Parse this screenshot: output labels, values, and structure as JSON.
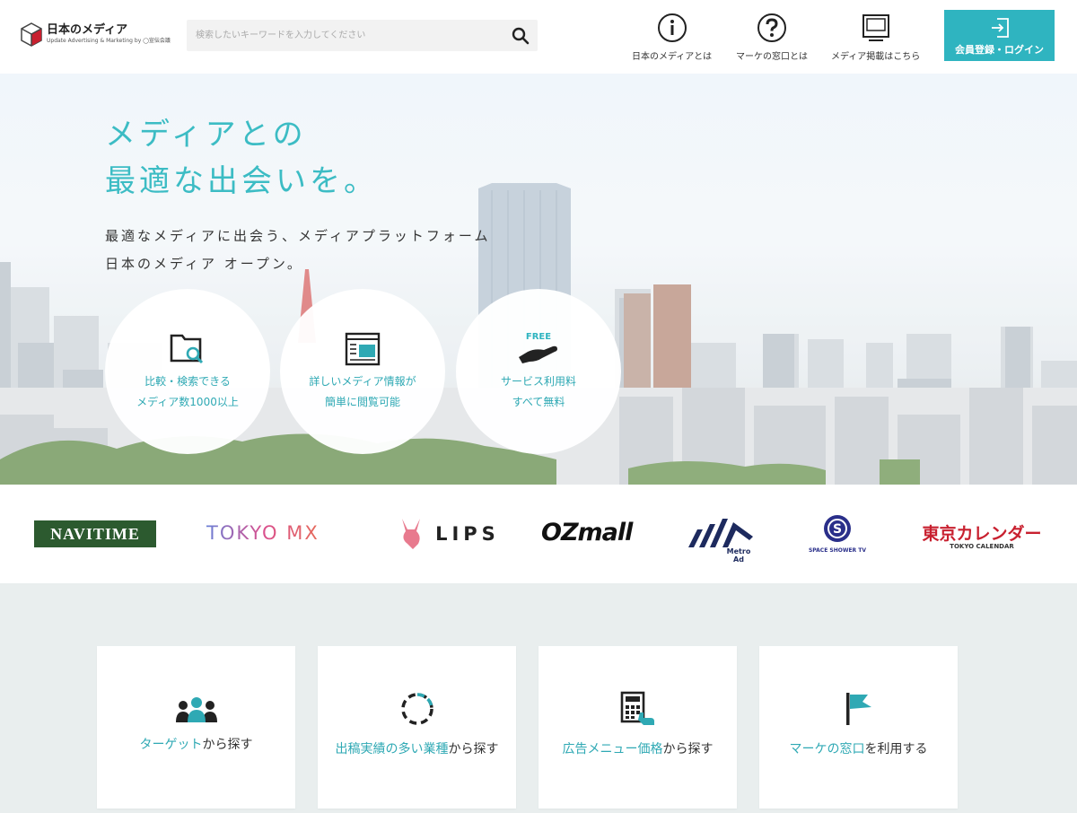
{
  "header": {
    "logo_title": "日本のメディア",
    "logo_sub": "Update Advertising & Marketing  by ◯宣伝会議",
    "search_placeholder": "検索したいキーワードを入力してください",
    "nav": [
      {
        "label": "日本のメディアとは",
        "icon": "info-icon"
      },
      {
        "label": "マーケの窓口とは",
        "icon": "question-icon"
      },
      {
        "label": "メディア掲載はこちら",
        "icon": "monitor-icon"
      }
    ],
    "login_label": "会員登録・ログイン"
  },
  "hero": {
    "title_line1": "メディアとの",
    "title_line2": "最適な出会いを。",
    "sub_line1": "最適なメディアに出会う、メディアプラットフォーム",
    "sub_line2": "日本のメディア オープン。",
    "features": [
      {
        "line1": "比較・検索できる",
        "line2": "メディア数1000以上",
        "icon": "folder-search-icon"
      },
      {
        "line1": "詳しいメディア情報が",
        "line2": "簡単に閲覧可能",
        "icon": "media-info-icon"
      },
      {
        "tag": "FREE",
        "line1": "サービス利用料",
        "line2": "すべて無料",
        "icon": "free-hand-icon"
      }
    ]
  },
  "brands": {
    "navitime": "NAVITIME",
    "tokyomx": "TOKYO MX",
    "lips": "LIPS",
    "ozmall": "OZmall",
    "metroad": "Metro Ad",
    "spaceshower": "SPACE SHOWER TV",
    "tokyocal_main": "東京カレンダー",
    "tokyocal_sub": "TOKYO CALENDAR"
  },
  "cards": [
    {
      "highlight": "ターゲット",
      "rest": "から探す",
      "icon": "people-icon"
    },
    {
      "highlight": "出稿実績の多い業種",
      "rest": "から探す",
      "icon": "dashed-circle-icon"
    },
    {
      "highlight": "広告メニュー価格",
      "rest": "から探す",
      "icon": "calculator-icon"
    },
    {
      "highlight": "マーケの窓口",
      "rest": "を利用する",
      "icon": "flag-icon"
    }
  ],
  "colors": {
    "accent": "#2fb4c0",
    "accent_text": "#3cbcc4"
  }
}
